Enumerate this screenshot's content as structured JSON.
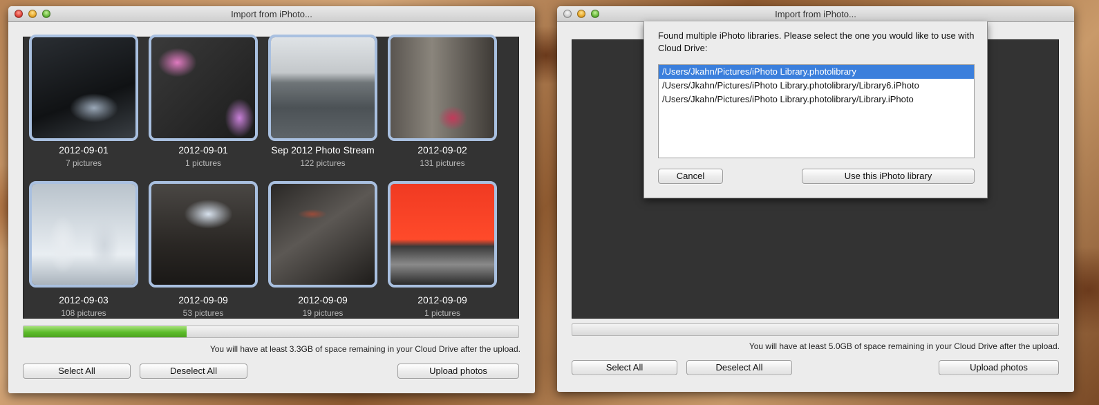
{
  "left_window": {
    "title": "Import from iPhoto...",
    "albums": [
      {
        "name": "2012-09-01",
        "count": "7 pictures"
      },
      {
        "name": "2012-09-01",
        "count": "1 pictures"
      },
      {
        "name": "Sep 2012 Photo Stream",
        "count": "122 pictures"
      },
      {
        "name": "2012-09-02",
        "count": "131 pictures"
      },
      {
        "name": "2012-09-03",
        "count": "108 pictures"
      },
      {
        "name": "2012-09-09",
        "count": "53 pictures"
      },
      {
        "name": "2012-09-09",
        "count": "19 pictures"
      },
      {
        "name": "2012-09-09",
        "count": "1 pictures"
      }
    ],
    "progress_fraction": 0.33,
    "space_text": "You will have at least 3.3GB of space remaining in your Cloud Drive after the upload.",
    "buttons": {
      "select_all": "Select All",
      "deselect_all": "Deselect All",
      "upload": "Upload photos"
    }
  },
  "right_window": {
    "title": "Import from iPhoto...",
    "dialog": {
      "message": "Found multiple iPhoto libraries. Please select the one you would like to use with Cloud Drive:",
      "libraries": [
        "/Users/Jkahn/Pictures/iPhoto Library.photolibrary",
        "/Users/Jkahn/Pictures/iPhoto Library.photolibrary/Library6.iPhoto",
        "/Users/Jkahn/Pictures/iPhoto Library.photolibrary/Library.iPhoto"
      ],
      "selected_index": 0,
      "cancel": "Cancel",
      "confirm": "Use this iPhoto library"
    },
    "progress_fraction": 0,
    "space_text": "You will have at least 5.0GB of space remaining in your Cloud Drive after the upload.",
    "buttons": {
      "select_all": "Select All",
      "deselect_all": "Deselect All",
      "upload": "Upload photos"
    }
  },
  "colors": {
    "selection": "#3b7fdc",
    "progress": "#5cbc2a",
    "thumb_border": "#a9c0e0"
  }
}
